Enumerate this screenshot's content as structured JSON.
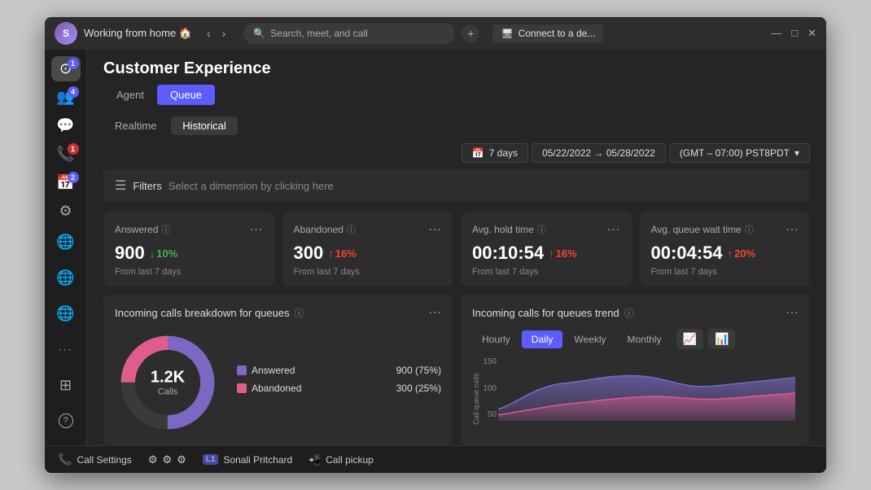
{
  "window": {
    "title": "Working from home 🏠",
    "search_placeholder": "Search, meet, and call",
    "connect_label": "Connect to a de...",
    "min": "—",
    "max": "□",
    "close": "✕"
  },
  "sidebar": {
    "icons": [
      {
        "name": "activity-icon",
        "glyph": "⊙",
        "badge": "1",
        "badge_type": "blue"
      },
      {
        "name": "people-icon",
        "glyph": "👥",
        "badge": "4",
        "badge_type": "blue"
      },
      {
        "name": "chat-icon",
        "glyph": "💬",
        "badge": null,
        "badge_type": null
      },
      {
        "name": "calls-icon",
        "glyph": "📞",
        "badge": "1",
        "badge_type": "red"
      },
      {
        "name": "calendar-icon",
        "glyph": "📅",
        "badge": "2",
        "badge_type": "blue"
      },
      {
        "name": "apps-icon",
        "glyph": "⚙",
        "badge": null,
        "badge_type": null
      }
    ],
    "bottom_icons": [
      {
        "name": "globe1-icon",
        "glyph": "🌐"
      },
      {
        "name": "globe2-icon",
        "glyph": "🌐"
      },
      {
        "name": "globe3-icon",
        "glyph": "🌐"
      },
      {
        "name": "more-icon",
        "glyph": "···"
      },
      {
        "name": "grid-icon",
        "glyph": "⊞"
      },
      {
        "name": "help-icon",
        "glyph": "?"
      }
    ]
  },
  "page": {
    "title": "Customer Experience",
    "tabs": [
      {
        "label": "Agent",
        "active": false
      },
      {
        "label": "Queue",
        "active": true
      }
    ],
    "sub_tabs": [
      {
        "label": "Realtime",
        "active": false
      },
      {
        "label": "Historical",
        "active": true
      }
    ]
  },
  "date_filter": {
    "days_label": "7 days",
    "range": "05/22/2022  →  05/28/2022",
    "timezone": "(GMT – 07:00) PST8PDT",
    "calendar_icon": "📅",
    "chevron": "▾"
  },
  "filter_bar": {
    "label": "Filters",
    "hint": "Select a dimension by clicking here"
  },
  "stats": [
    {
      "title": "Answered",
      "value": "900",
      "change": "10%",
      "change_dir": "down",
      "change_arrow": "↓",
      "sub": "From last 7 days"
    },
    {
      "title": "Abandoned",
      "value": "300",
      "change": "16%",
      "change_dir": "up",
      "change_arrow": "↑",
      "sub": "From last 7 days"
    },
    {
      "title": "Avg. hold time",
      "value": "00:10:54",
      "change": "16%",
      "change_dir": "up",
      "change_arrow": "↑",
      "sub": "From last 7 days"
    },
    {
      "title": "Avg. queue wait time",
      "value": "00:04:54",
      "change": "20%",
      "change_dir": "up",
      "change_arrow": "↑",
      "sub": "From last 7 days"
    }
  ],
  "donut_chart": {
    "title": "Incoming calls breakdown for queues",
    "center_value": "1.2K",
    "center_sub": "Calls",
    "legend": [
      {
        "label": "Answered",
        "count": "900 (75%)",
        "color": "#7c68c3"
      },
      {
        "label": "Abandoned",
        "count": "300 (25%)",
        "color": "#e05c8e"
      }
    ],
    "answered_pct": 75,
    "abandoned_pct": 25
  },
  "trend_chart": {
    "title": "Incoming calls for queues trend",
    "tabs": [
      "Hourly",
      "Daily",
      "Weekly",
      "Monthly"
    ],
    "active_tab": "Daily",
    "y_label": "Call queue calls",
    "y_axis": [
      150,
      100,
      50
    ],
    "colors": {
      "answered": "#7c68c3",
      "abandoned": "#e05c8e"
    }
  },
  "bottom_bar": {
    "call_settings": "Call Settings",
    "user_badge": "L1",
    "user_name": "Sonali Pritchard",
    "call_pickup": "Call pickup"
  }
}
